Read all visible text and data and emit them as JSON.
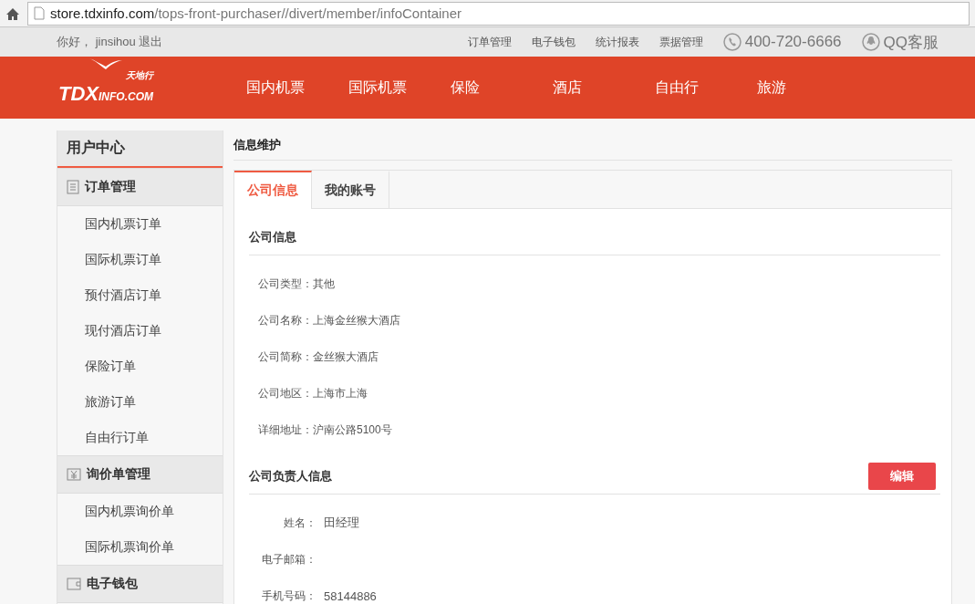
{
  "browser": {
    "url_host": "store.tdxinfo.com",
    "url_path": "/tops-front-purchaser//divert/member/infoContainer"
  },
  "top_bar": {
    "greeting": "你好，",
    "username": "jinsihou",
    "logout": "退出",
    "links": [
      "订单管理",
      "电子钱包",
      "统计报表",
      "票据管理"
    ],
    "phone": "400-720-6666",
    "qq": "QQ客服"
  },
  "header": {
    "logo": {
      "brand": "TDX",
      "suffix": "INFO.COM",
      "chinese": "天地行"
    },
    "nav": [
      "国内机票",
      "国际机票",
      "保险",
      "酒店",
      "自由行",
      "旅游"
    ]
  },
  "sidebar": {
    "title": "用户中心",
    "groups": [
      {
        "title": "订单管理",
        "kind": "list",
        "items": [
          "国内机票订单",
          "国际机票订单",
          "预付酒店订单",
          "现付酒店订单",
          "保险订单",
          "旅游订单",
          "自由行订单"
        ]
      },
      {
        "title": "询价单管理",
        "kind": "price",
        "items": [
          "国内机票询价单",
          "国际机票询价单"
        ]
      },
      {
        "title": "电子钱包",
        "kind": "wallet"
      }
    ]
  },
  "content": {
    "title": "信息维护",
    "tabs": [
      {
        "label": "公司信息",
        "selected": true
      },
      {
        "label": "我的账号",
        "selected": false
      }
    ],
    "sections": [
      {
        "title": "公司信息",
        "kind": "plain",
        "rows": [
          {
            "label": "公司类型：",
            "value": "其他"
          },
          {
            "label": "公司名称：",
            "value": "上海金丝猴大酒店"
          },
          {
            "label": "公司简称：",
            "value": "金丝猴大酒店"
          },
          {
            "label": "公司地区：",
            "value": "上海市上海"
          },
          {
            "label": "详细地址：",
            "value": "沪南公路5100号"
          }
        ]
      },
      {
        "title": "公司负责人信息",
        "kind": "form",
        "button": "编辑",
        "rows": [
          {
            "label": "姓名：",
            "value": "田经理"
          },
          {
            "label": "电子邮箱："
          },
          {
            "label": "手机号码：",
            "value": "58144886"
          }
        ]
      }
    ]
  }
}
